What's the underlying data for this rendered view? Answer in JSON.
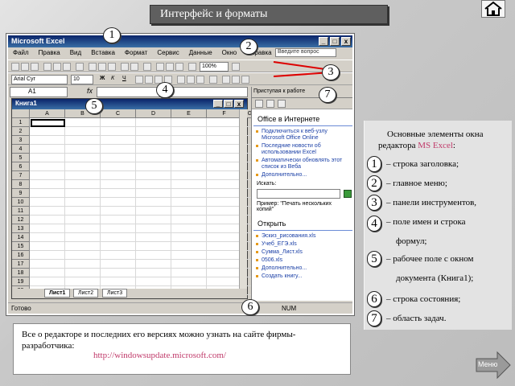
{
  "slide_title": "Интерфейс и форматы",
  "excel": {
    "window_title": "Microsoft Excel",
    "title_controls": [
      "_",
      "□",
      "x"
    ],
    "menu": [
      "Файл",
      "Правка",
      "Вид",
      "Вставка",
      "Формат",
      "Сервис",
      "Данные",
      "Окно",
      "Справка"
    ],
    "ask_placeholder": "Введите вопрос",
    "zoom": "100%",
    "font_name": "Arial Cyr",
    "font_size": "10",
    "format_buttons": [
      "Ж",
      "К",
      "Ч"
    ],
    "namebox_value": "A1",
    "fx_label": "fx",
    "workbook_title": "Книга1",
    "columns": [
      "A",
      "B",
      "C",
      "D",
      "E",
      "F",
      "G"
    ],
    "rows": [
      "1",
      "2",
      "3",
      "4",
      "5",
      "6",
      "7",
      "8",
      "9",
      "10",
      "11",
      "12",
      "13",
      "14",
      "15",
      "16",
      "17",
      "18",
      "19",
      "20"
    ],
    "sheet_tabs": [
      "Лист1",
      "Лист2",
      "Лист3"
    ],
    "status_left": "Готово",
    "status_right": "NUM",
    "taskpane": {
      "title": "Приступая к работе",
      "section1": "Office в Интернете",
      "links1": [
        "Подключиться к веб-узлу Microsoft Office Online",
        "Последние новости об использовании Excel",
        "Автоматически обновлять этот список из Веба",
        "Дополнительно..."
      ],
      "search_label": "Искать:",
      "example": "Пример: \"Печать нескольких копий\"",
      "section2": "Открыть",
      "links2": [
        "Эскиз_рисования.xls",
        "Учеб_ЕГЭ.xls",
        "Сумма_Лист.xls",
        "0506.xls",
        "Дополнительно..."
      ],
      "create_link": "Создать книгу..."
    }
  },
  "badges": [
    "1",
    "2",
    "3",
    "4",
    "5",
    "6",
    "7"
  ],
  "legend": {
    "intro_before": "Основные элементы окна редактора ",
    "intro_accent": "MS Excel",
    "intro_after": ":",
    "items": [
      {
        "num": "1",
        "text": "– строка заголовка;"
      },
      {
        "num": "2",
        "text": "– главное меню;"
      },
      {
        "num": "3",
        "text": "– панели инструментов,"
      },
      {
        "num": "4",
        "text": "– поле имен и строка"
      },
      {
        "num": "",
        "text": "формул;"
      },
      {
        "num": "5",
        "text": "– рабочее поле с окном"
      },
      {
        "num": "",
        "text": "документа (Книга1);"
      },
      {
        "num": "6",
        "text": "– строка состояния;"
      },
      {
        "num": "7",
        "text": "– область задач."
      }
    ]
  },
  "note": {
    "text": "Все о редакторе и последних его версиях можно узнать на сайте фирмы-разработчика:",
    "link": "http://windowsupdate.microsoft.com/"
  },
  "menu_button_label": "Меню"
}
